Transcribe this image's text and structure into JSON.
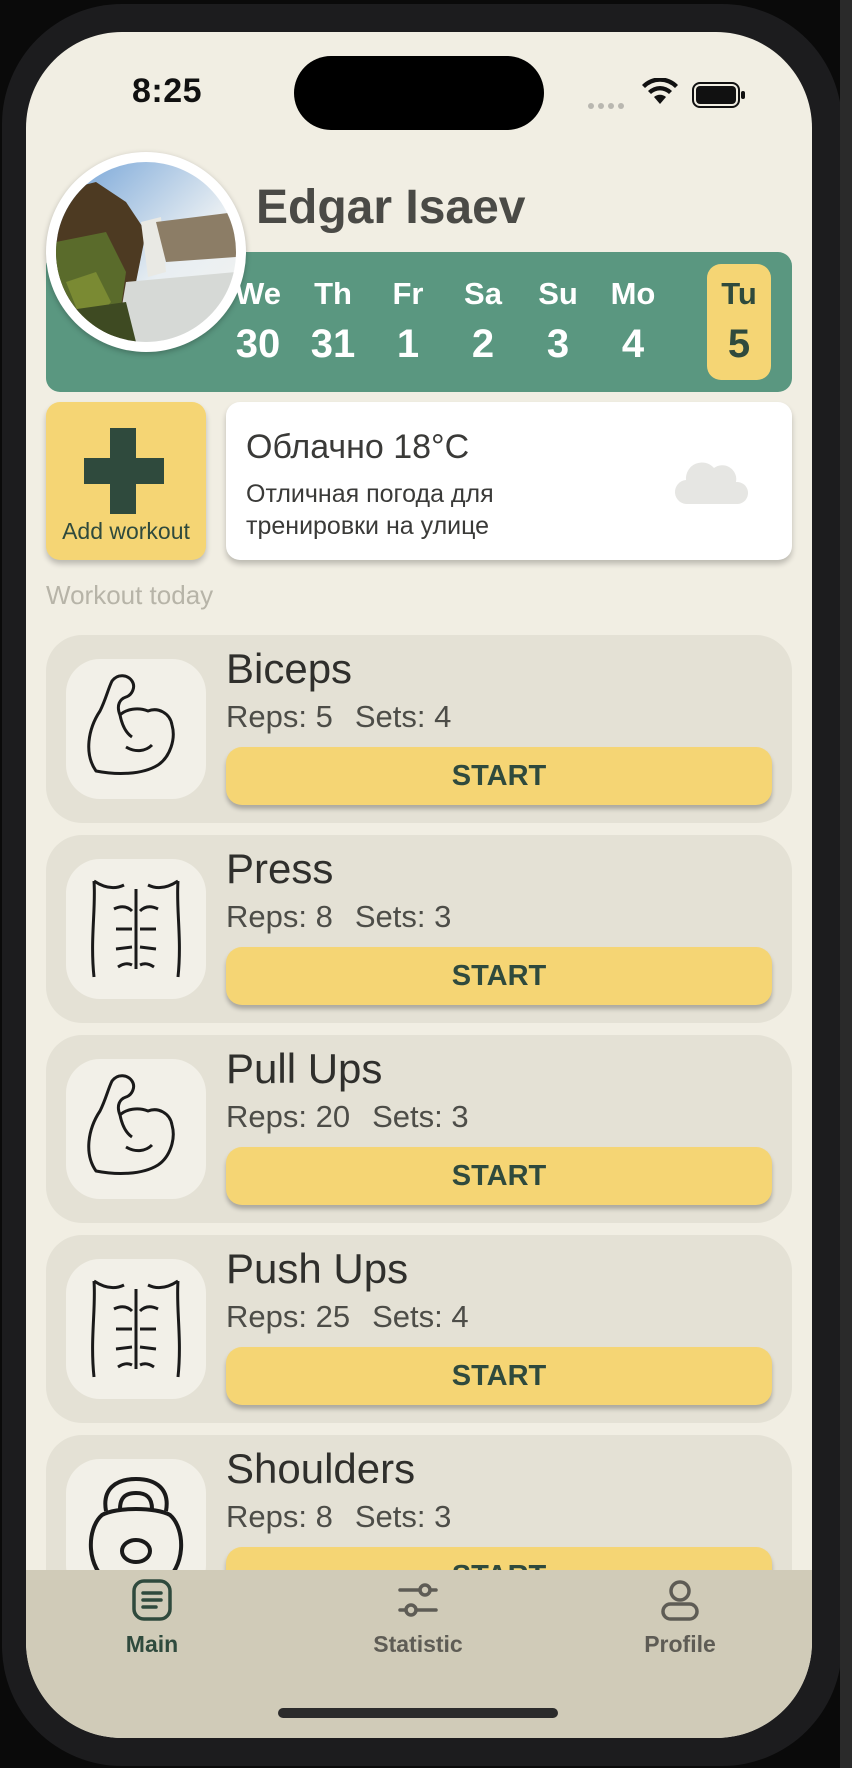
{
  "status_bar": {
    "time": "8:25",
    "icons": [
      "signal-dots-icon",
      "wifi-icon",
      "battery-icon"
    ]
  },
  "profile": {
    "name": "Edgar Isaev",
    "avatar": "waterfall-photo"
  },
  "calendar": {
    "days": [
      {
        "name": "We",
        "date": "30",
        "active": false
      },
      {
        "name": "Th",
        "date": "31",
        "active": false
      },
      {
        "name": "Fr",
        "date": "1",
        "active": false
      },
      {
        "name": "Sa",
        "date": "2",
        "active": false
      },
      {
        "name": "Su",
        "date": "3",
        "active": false
      },
      {
        "name": "Mo",
        "date": "4",
        "active": false
      },
      {
        "name": "Tu",
        "date": "5",
        "active": true
      }
    ]
  },
  "add_workout": {
    "label": "Add workout",
    "icon": "plus-icon"
  },
  "weather": {
    "title": "Облачно 18°C",
    "description": "Отличная погода для тренировки на улице",
    "icon": "cloud-icon"
  },
  "section_title": "Workout today",
  "workouts": [
    {
      "name": "Biceps",
      "reps": "Reps: 5",
      "sets": "Sets: 4",
      "button": "START",
      "icon": "bicep-icon"
    },
    {
      "name": "Press",
      "reps": "Reps: 8",
      "sets": "Sets: 3",
      "button": "START",
      "icon": "abs-icon"
    },
    {
      "name": "Pull Ups",
      "reps": "Reps: 20",
      "sets": "Sets: 3",
      "button": "START",
      "icon": "bicep-icon"
    },
    {
      "name": "Push Ups",
      "reps": "Reps: 25",
      "sets": "Sets: 4",
      "button": "START",
      "icon": "abs-icon"
    },
    {
      "name": "Shoulders",
      "reps": "Reps: 8",
      "sets": "Sets: 3",
      "button": "START",
      "icon": "kettlebell-icon"
    }
  ],
  "tabbar": {
    "items": [
      {
        "label": "Main",
        "icon": "document-list-icon",
        "active": true
      },
      {
        "label": "Statistic",
        "icon": "sliders-icon",
        "active": false
      },
      {
        "label": "Profile",
        "icon": "person-icon",
        "active": false
      }
    ]
  },
  "colors": {
    "background": "#f1eee3",
    "accent_green": "#5a9780",
    "accent_yellow": "#f5d574",
    "dark_green": "#2f4a3d",
    "card": "#e4e1d5",
    "tabbar": "#d0cbb8"
  }
}
